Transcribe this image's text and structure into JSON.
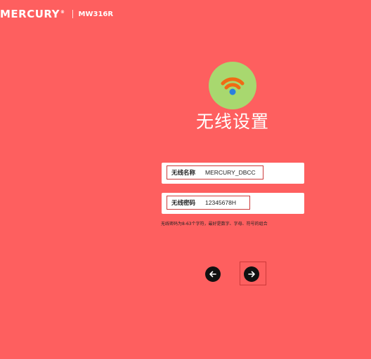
{
  "brand": {
    "name": "MERCURY",
    "registered_mark": "®",
    "model": "MW316R"
  },
  "page": {
    "title": "无线设置",
    "icon": "wifi-icon"
  },
  "wifi_name": {
    "label": "无线名称",
    "value": "MERCURY_DBCC"
  },
  "wifi_password": {
    "label": "无线密码",
    "value": "12345678H",
    "hint": "无线密码为8-63个字符，最好是数字、字母、符号的组合"
  },
  "nav": {
    "back_icon": "arrow-left-icon",
    "next_icon": "arrow-right-icon"
  },
  "colors": {
    "background": "#fe5f5f",
    "icon_badge": "#a8d86f",
    "wifi_orange": "#f06a14",
    "wifi_dot": "#2a7fe0",
    "highlight_border": "#cc3a3a",
    "button": "#111111"
  }
}
